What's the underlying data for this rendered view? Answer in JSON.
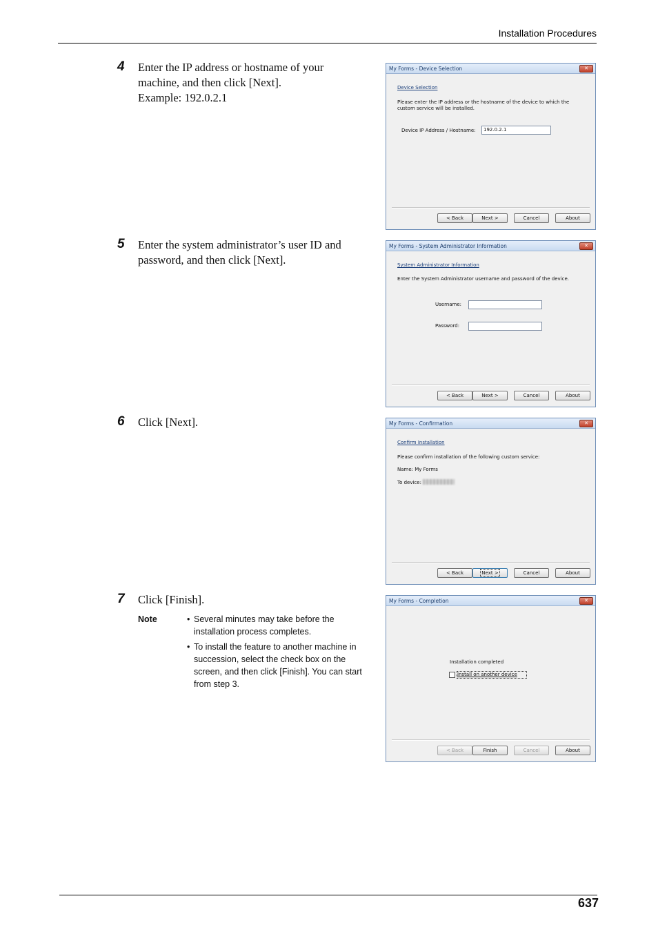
{
  "header": {
    "title": "Installation Procedures"
  },
  "footer": {
    "page_number": "637"
  },
  "steps": [
    {
      "number": "4",
      "lines": [
        "Enter the IP address or hostname of your",
        "machine, and then click [Next].",
        "Example: 192.0.2.1"
      ]
    },
    {
      "number": "5",
      "lines": [
        "Enter the system administrator’s user ID and",
        "password, and then click [Next]."
      ]
    },
    {
      "number": "6",
      "lines": [
        "Click [Next]."
      ]
    },
    {
      "number": "7",
      "lines": [
        "Click [Finish]."
      ]
    }
  ],
  "note": {
    "label": "Note",
    "items": [
      "Several minutes may take before the installation process completes.",
      "To install the feature to another machine in succession, select the check box on the screen, and then click [Finish]. You can start from step 3."
    ]
  },
  "dialogs": {
    "device_selection": {
      "title": "My Forms - Device Selection",
      "heading": "Device Selection",
      "description": "Please enter the IP address or the hostname of the device to which the custom service will be installed.",
      "field_label": "Device IP Address / Hostname:",
      "field_value": "192.0.2.1",
      "buttons": {
        "back": "< Back",
        "next": "Next >",
        "cancel": "Cancel",
        "about": "About"
      }
    },
    "admin_info": {
      "title": "My Forms - System Administrator Information",
      "heading": "System Administrator Information",
      "description": "Enter the System Administrator username and password of the device.",
      "username_label": "Username:",
      "password_label": "Password:",
      "username_value": "",
      "password_value": "",
      "buttons": {
        "back": "< Back",
        "next": "Next >",
        "cancel": "Cancel",
        "about": "About"
      }
    },
    "confirmation": {
      "title": "My Forms - Confirmation",
      "heading": "Confirm Installation",
      "description": "Please confirm installation of the following custom service:",
      "name_line": "Name: My Forms",
      "device_label": "To device:",
      "buttons": {
        "back": "< Back",
        "next": "Next >",
        "cancel": "Cancel",
        "about": "About"
      }
    },
    "completion": {
      "title": "My Forms - Completion",
      "message": "Installation completed",
      "checkbox_label": "Install on another device",
      "checkbox_checked": false,
      "buttons": {
        "back": "< Back",
        "finish": "Finish",
        "cancel": "Cancel",
        "about": "About"
      }
    }
  },
  "colors": {
    "title_bar": "#c9dbf1",
    "close_button": "#c2412b",
    "dialog_background": "#f0f0f0"
  }
}
